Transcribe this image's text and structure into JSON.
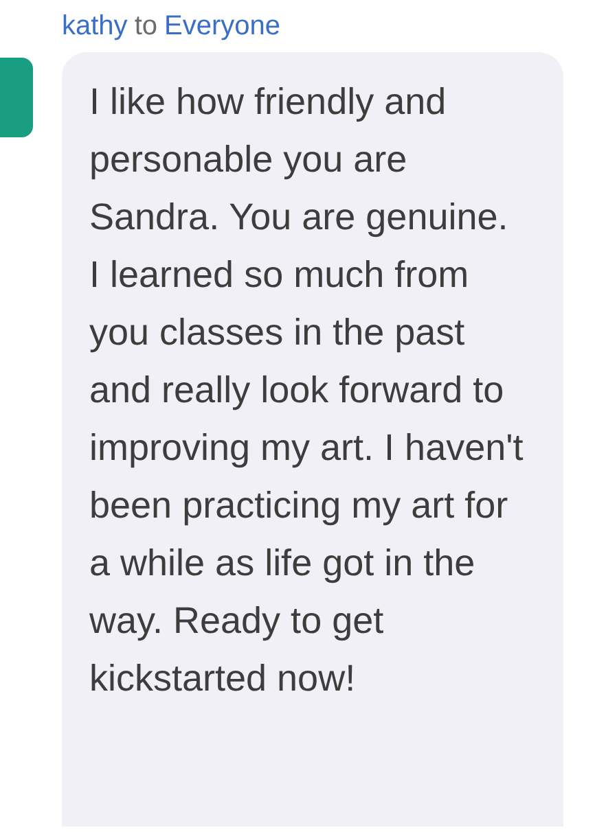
{
  "message": {
    "sender": "kathy",
    "connector": "to",
    "recipient": "Everyone",
    "text": "I like how friendly and personable you are Sandra. You are genuine. I learned so much from you classes in the past and really look forward to improving my art. I haven't been practicing my art for a while as life got in the way. Ready to get kickstarted now!"
  }
}
